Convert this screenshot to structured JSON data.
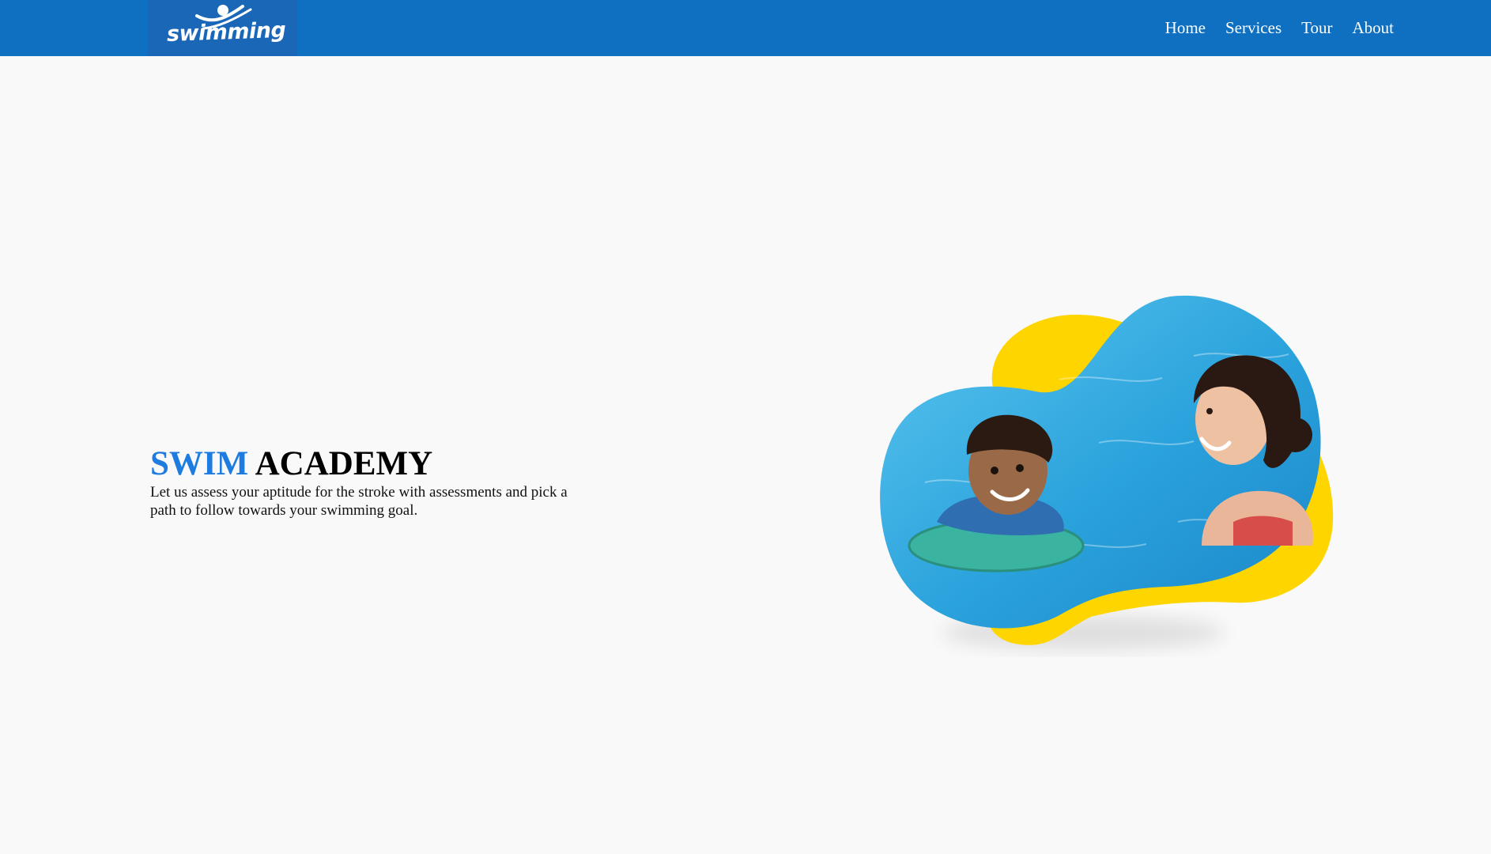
{
  "header": {
    "logo_text": "swimming",
    "nav": [
      "Home",
      "Services",
      "Tour",
      "About"
    ],
    "colors": {
      "bar": "#0f6fc0",
      "logo_bg": "#1a67b8"
    }
  },
  "hero": {
    "title_accent": "SWIM",
    "title_rest": "ACADEMY",
    "subtitle": "Let us assess your aptitude for the stroke with assessments and pick a path to follow towards your swimming goal.",
    "colors": {
      "accent": "#1e7be0",
      "blob": "#ffd500",
      "water": "#2fa8e0"
    },
    "image_subject": "child in swim float and woman smiling in a pool"
  }
}
